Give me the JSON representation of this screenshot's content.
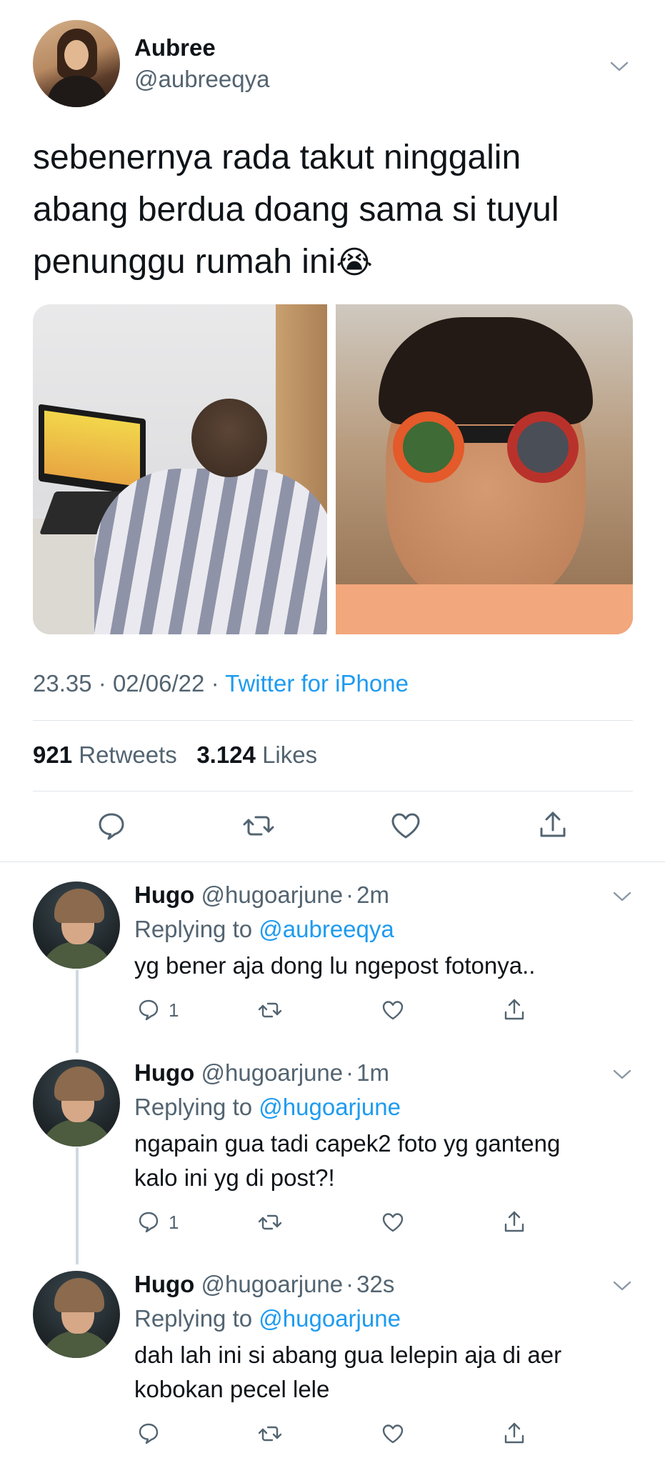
{
  "main_tweet": {
    "author_name": "Aubree",
    "author_handle": "@aubreeqya",
    "text_lines": [
      "sebenernya rada takut ninggalin",
      "abang berdua doang sama si tuyul",
      "penunggu rumah ini"
    ],
    "emoji": "😭",
    "time": "23.35",
    "separator": "·",
    "date": "02/06/22",
    "source": "Twitter for iPhone",
    "retweets_count": "921",
    "retweets_label": "Retweets",
    "likes_count": "3.124",
    "likes_label": "Likes",
    "actions": [
      "reply-icon",
      "retweet-icon",
      "like-icon",
      "share-icon"
    ]
  },
  "replies": [
    {
      "name": "Hugo",
      "handle": "@hugoarjune",
      "sep": "·",
      "time": "2m",
      "replying_prefix": "Replying to",
      "replying_to": "@aubreeqya",
      "text_lines": [
        "yg bener aja dong lu ngepost fotonya.."
      ],
      "reply_count": "1"
    },
    {
      "name": "Hugo",
      "handle": "@hugoarjune",
      "sep": "·",
      "time": "1m",
      "replying_prefix": "Replying to",
      "replying_to": "@hugoarjune",
      "text_lines": [
        "ngapain gua tadi capek2 foto yg ganteng",
        "kalo ini yg di post?!"
      ],
      "reply_count": "1"
    },
    {
      "name": "Hugo",
      "handle": "@hugoarjune",
      "sep": "·",
      "time": "32s",
      "replying_prefix": "Replying to",
      "replying_to": "@hugoarjune",
      "text_lines": [
        "dah lah ini si abang gua lelepin aja di aer",
        "kobokan pecel lele"
      ],
      "reply_count": ""
    }
  ],
  "colors": {
    "accent": "#1d9bf0",
    "secondary_text": "#536471",
    "primary_text": "#0f1419",
    "divider": "#e1e6ea"
  }
}
